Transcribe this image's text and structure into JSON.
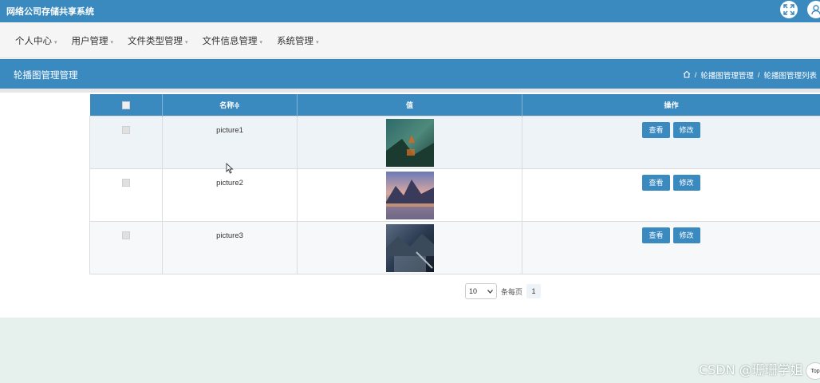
{
  "app": {
    "title": "网络公司存储共享系统"
  },
  "topbar": {
    "fullscreen_icon": "fullscreen-icon",
    "user_icon": "user-icon"
  },
  "nav": {
    "items": [
      {
        "label": "个人中心"
      },
      {
        "label": "用户管理"
      },
      {
        "label": "文件类型管理"
      },
      {
        "label": "文件信息管理"
      },
      {
        "label": "系统管理"
      }
    ],
    "caret": "▾"
  },
  "section": {
    "title": "轮播图管理管理",
    "breadcrumb": {
      "home_icon": "home-icon",
      "sep": "/",
      "level1": "轮播图管理管理",
      "level2": "轮播图管理列表"
    }
  },
  "table": {
    "columns": {
      "name": "名称≑",
      "value": "值",
      "actions": "操作"
    },
    "rows": [
      {
        "name": "picture1",
        "view": "查看",
        "edit": "修改"
      },
      {
        "name": "picture2",
        "view": "查看",
        "edit": "修改"
      },
      {
        "name": "picture3",
        "view": "查看",
        "edit": "修改"
      }
    ]
  },
  "pagination": {
    "page_size": "10",
    "per_page_label": "条每页",
    "current_page": "1"
  },
  "watermark": "CSDN @珊珊学姐",
  "back_to_top": "Top",
  "colors": {
    "primary": "#3a8ac0",
    "footer_bg": "#e6f0ec"
  }
}
